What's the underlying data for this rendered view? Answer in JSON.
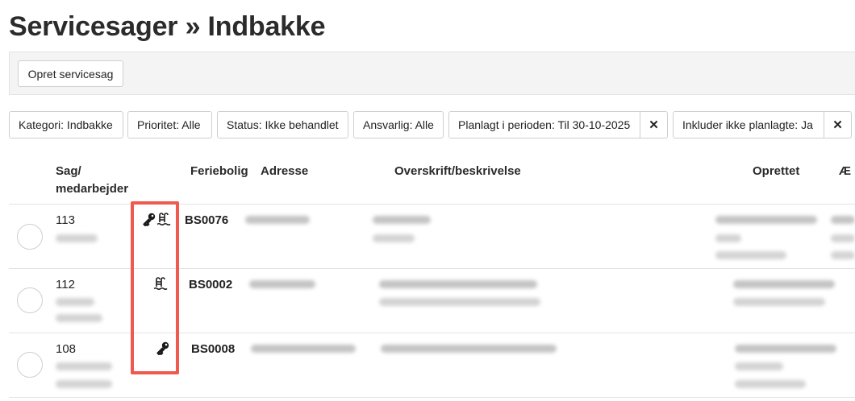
{
  "header": {
    "title": "Servicesager » Indbakke"
  },
  "toolbar": {
    "create_label": "Opret servicesag"
  },
  "filters": [
    {
      "label": "Kategori: Indbakke"
    },
    {
      "label": "Prioritet: Alle"
    },
    {
      "label": "Status: Ikke behandlet"
    },
    {
      "label": "Ansvarlig: Alle"
    },
    {
      "label": "Planlagt i perioden: Til 30-10-2025",
      "clear": "✕"
    },
    {
      "label": "Inkluder ikke planlagte: Ja",
      "clear": "✕"
    }
  ],
  "table": {
    "columns": {
      "case_line1": "Sag/",
      "case_line2": "medarbejder",
      "property": "Feriebolig",
      "address": "Adresse",
      "description": "Overskrift/beskrivelse",
      "created": "Oprettet",
      "extra": "Æ"
    },
    "rows": [
      {
        "case": "113",
        "property": "BS0076",
        "icons": [
          "key-icon",
          "pool-ladder-icon"
        ]
      },
      {
        "case": "112",
        "property": "BS0002",
        "icons": [
          "pool-ladder-icon"
        ]
      },
      {
        "case": "108",
        "property": "BS0008",
        "icons": [
          "key-icon"
        ]
      }
    ]
  },
  "colors": {
    "highlight": "#ef5a4f",
    "toolbar_bg": "#f4f4f4",
    "border": "#cfcfcf"
  }
}
